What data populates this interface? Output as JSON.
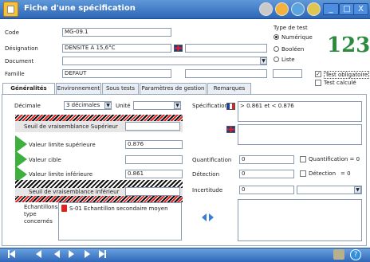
{
  "window": {
    "title": "Fiche d'une spécification",
    "minimize_glyph": "_",
    "maximize_glyph": "□",
    "close_glyph": "X"
  },
  "form": {
    "code_label": "Code",
    "code_value": "MG-09.1",
    "designation_label": "Désignation",
    "designation_value": "DENSITE A 15,6°C",
    "document_label": "Document",
    "document_value": "",
    "famille_label": "Famille",
    "famille_value": "DEFAUT"
  },
  "test_type": {
    "label": "Type de test",
    "options": [
      "Numérique",
      "Booléen",
      "Liste"
    ],
    "selected": "Numérique",
    "logo_text": "123"
  },
  "checkboxes": {
    "test_obligatoire": "Test obligatoire",
    "test_calcule": "Test calculé"
  },
  "tabs": [
    "Généralités",
    "Environnement",
    "Sous tests",
    "Paramètres de gestion",
    "Remarques"
  ],
  "general": {
    "decimale_label": "Décimale",
    "decimale_value": "3 décimales",
    "unite_label": "Unité",
    "unite_value": "",
    "seuil_sup_label": "Seuil de vraisemblance Supérieur",
    "limite_sup_label": "Valeur limite supérieure",
    "limite_sup_value": "0.876",
    "cible_label": "Valeur cible",
    "cible_value": "",
    "limite_inf_label": "Valeur limite inférieure",
    "limite_inf_value": "0.861",
    "seuil_inf_label": "Seuil de vraisemblance inférieur",
    "echantillons_label": "Echantillons type concernés",
    "echantillon_item": "S-01 Echantillon secondaire moyen"
  },
  "specification": {
    "label": "Spécification",
    "value_fr": "> 0.861 et < 0.876",
    "value_en": ""
  },
  "measures": {
    "quantification_label": "Quantification",
    "quantification_value": "0",
    "quantification_eq_label": "Quantification = 0",
    "detection_label": "Détection",
    "detection_value": "0",
    "detection_eq_label": "Détection",
    "detection_eq_value": "= 0",
    "incertitude_label": "Incertitude",
    "incertitude_value": "0"
  },
  "colors": {
    "title_bar": "#2d66b5",
    "accent_green": "#3db03d",
    "hatch_red": "#dd2222"
  }
}
